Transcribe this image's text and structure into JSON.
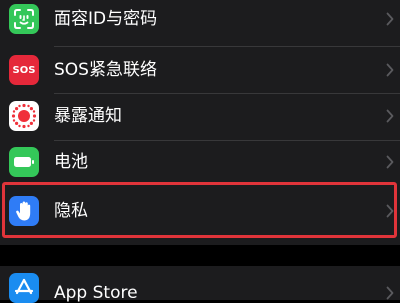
{
  "settings_list": {
    "items": [
      {
        "label": "面容ID与密码",
        "icon": "face-id-icon",
        "color": "#34c759"
      },
      {
        "label": "SOS紧急联络",
        "icon": "sos-icon",
        "color": "#e5283a",
        "badge": "SOS"
      },
      {
        "label": "暴露通知",
        "icon": "exposure-notification-icon",
        "color": "#ffffff"
      },
      {
        "label": "电池",
        "icon": "battery-icon",
        "color": "#34c759"
      },
      {
        "label": "隐私",
        "icon": "privacy-hand-icon",
        "color": "#2f7cf6"
      }
    ],
    "app_store": {
      "label": "App Store",
      "icon": "app-store-icon",
      "color": "#1a8cf0"
    }
  },
  "highlight_color": "#e0343a"
}
